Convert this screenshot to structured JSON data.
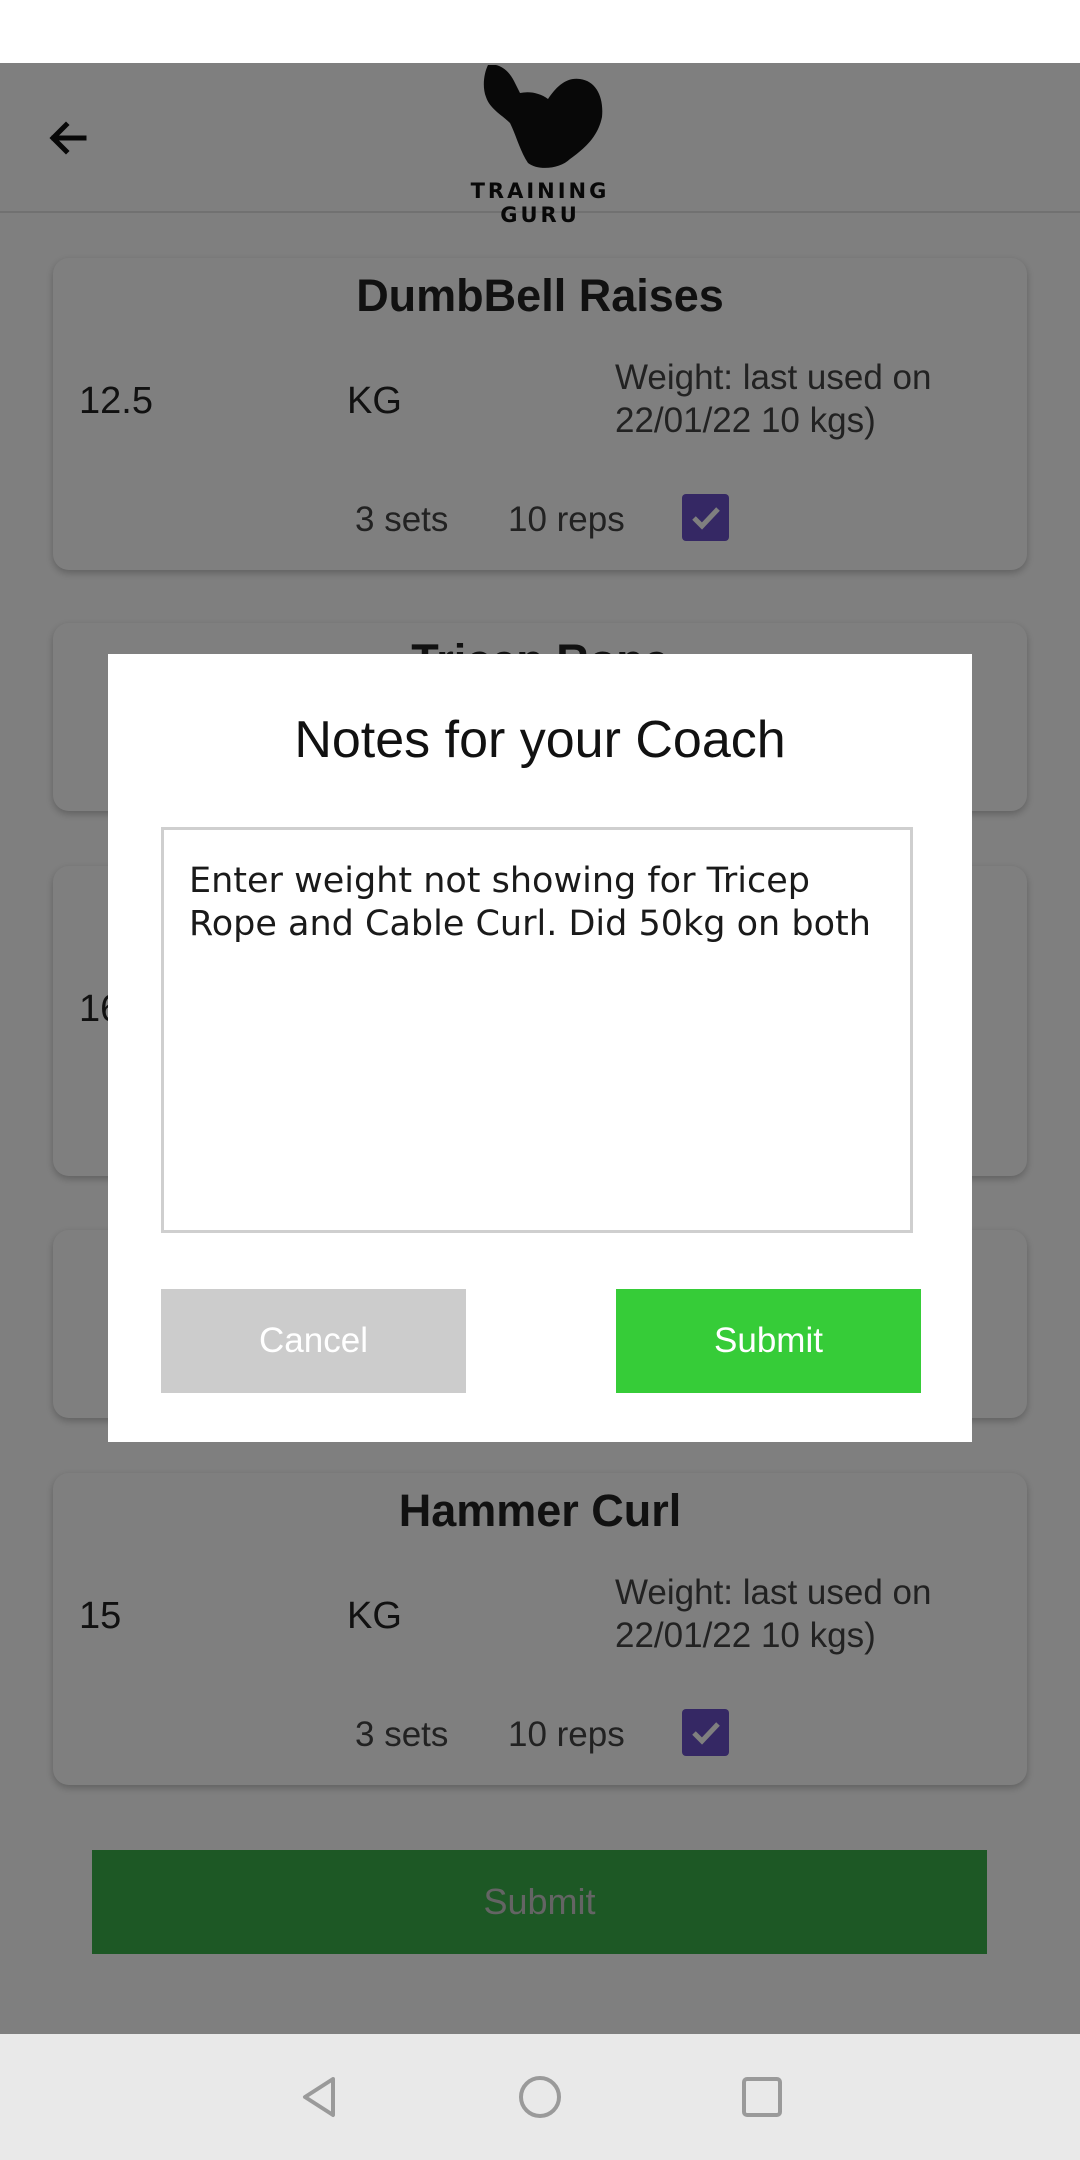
{
  "app": {
    "logo_text": "TRAINING GURU"
  },
  "exercises": [
    {
      "title": "DumbBell Raises",
      "weight": "12.5",
      "unit": "KG",
      "last_used": "Weight: last used on 22/01/22  10 kgs)",
      "sets": "3 sets",
      "reps": "10 reps",
      "done": true
    },
    {
      "title": "Tricep Rope"
    },
    {
      "weight_partial": "16"
    },
    {},
    {
      "title": "Hammer Curl",
      "weight": "15",
      "unit": "KG",
      "last_used": "Weight: last used on 22/01/22  10 kgs)",
      "sets": "3 sets",
      "reps": "10 reps",
      "done": true
    }
  ],
  "main_submit_label": "Submit",
  "dialog": {
    "title": "Notes for your Coach",
    "notes_value": "Enter weight not showing for Tricep Rope and Cable Curl. Did 50kg on both",
    "cancel_label": "Cancel",
    "submit_label": "Submit"
  },
  "colors": {
    "accent_green": "#36cc38",
    "checkbox_purple": "#6a50c8",
    "scrim": "rgba(0,0,0,0.5)"
  },
  "icons": {
    "back": "arrow-left-icon",
    "checkbox": "check-icon",
    "nav": [
      "back-triangle-icon",
      "home-circle-icon",
      "recents-square-icon"
    ]
  }
}
